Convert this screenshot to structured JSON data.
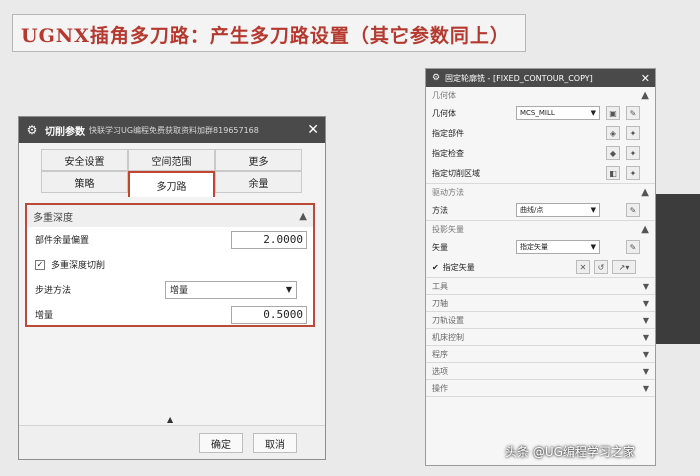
{
  "banner": {
    "text": "UGNX插角多刀路：产生多刀路设置（其它参数同上）"
  },
  "dialog": {
    "title": "切削参数",
    "subtitle": "快联学习UG编程免费获取资料加群819657168",
    "close_glyph": "✕",
    "tabs_row1": [
      "安全设置",
      "空间范围",
      "更多"
    ],
    "tabs_row2": [
      "策略",
      "多刀路",
      "余量"
    ],
    "active_tab": "多刀路",
    "group": {
      "title": "多重深度",
      "stock_label": "部件余量偏置",
      "stock_value": "2.0000",
      "multi_depth_label": "多重深度切削",
      "multi_depth_checked": true,
      "step_label": "步进方法",
      "step_value": "增量",
      "increment_label": "增量",
      "increment_value": "0.5000"
    },
    "ok_label": "确定",
    "cancel_label": "取消"
  },
  "panel": {
    "title": "固定轮廓铣 - [FIXED_CONTOUR_COPY]",
    "geometry_head": "几何体",
    "geometry_label": "几何体",
    "geometry_value": "MCS_MILL",
    "part_label": "指定部件",
    "check_label": "指定检查",
    "cut_area_label": "指定切削区域",
    "drive_head": "驱动方法",
    "method_label": "方法",
    "method_value": "曲线/点",
    "proj_head": "投影矢量",
    "vector_label": "矢量",
    "vector_value": "指定矢量",
    "spec_vector_label": "指定矢量",
    "collapsed": [
      "工具",
      "刀轴",
      "刀轨设置",
      "机床控制",
      "程序",
      "选项",
      "操作"
    ]
  },
  "watermark": "头条 @UG编程学习之家",
  "colors": {
    "accent_red": "#b94a35",
    "title_bar": "#4a4a4a"
  }
}
